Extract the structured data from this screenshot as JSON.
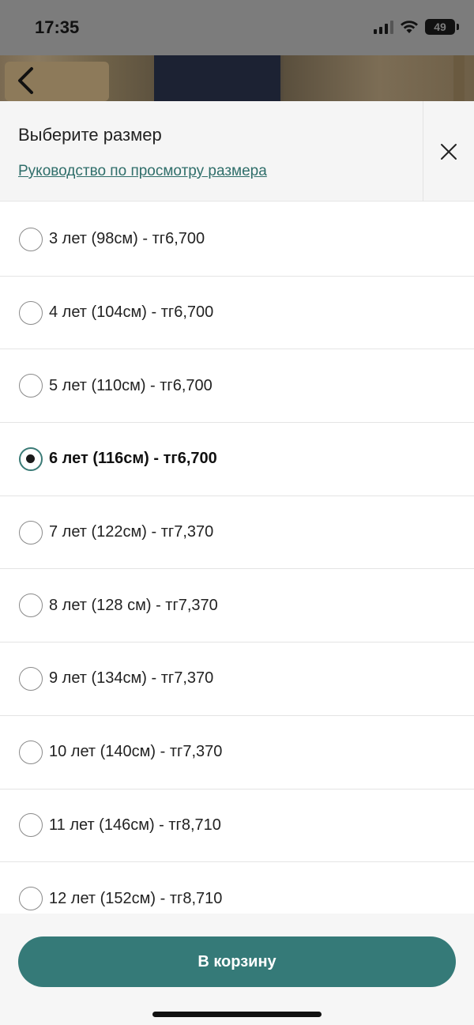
{
  "status_bar": {
    "time": "17:35",
    "battery": "49",
    "icons": [
      "signal-icon",
      "wifi-icon",
      "battery-icon"
    ]
  },
  "nav": {
    "back_icon": "chevron-left-icon"
  },
  "sheet": {
    "title": "Выберите размер",
    "size_guide_link": "Руководство по просмотру размера",
    "close_icon": "close-icon"
  },
  "sizes": [
    {
      "label": "3 лет (98см) - тг6,700",
      "selected": false
    },
    {
      "label": "4 лет (104см) - тг6,700",
      "selected": false
    },
    {
      "label": "5 лет (110см) - тг6,700",
      "selected": false
    },
    {
      "label": "6 лет (116см) - тг6,700",
      "selected": true
    },
    {
      "label": "7 лет (122см) - тг7,370",
      "selected": false
    },
    {
      "label": "8 лет (128 см) - тг7,370",
      "selected": false
    },
    {
      "label": "9 лет (134см) - тг7,370",
      "selected": false
    },
    {
      "label": "10 лет (140см) - тг7,370",
      "selected": false
    },
    {
      "label": "11 лет (146см) - тг8,710",
      "selected": false
    },
    {
      "label": "12 лет (152см) - тг8,710",
      "selected": false
    }
  ],
  "footer": {
    "cart_button": "В корзину"
  },
  "colors": {
    "accent": "#357a78",
    "link": "#2f6e6a"
  }
}
